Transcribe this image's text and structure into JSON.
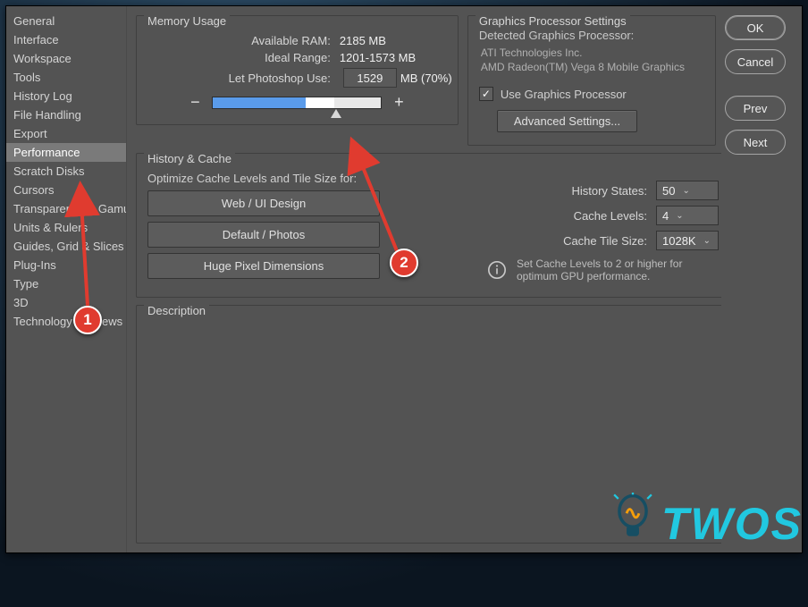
{
  "sidebar": {
    "items": [
      {
        "label": "General"
      },
      {
        "label": "Interface"
      },
      {
        "label": "Workspace"
      },
      {
        "label": "Tools"
      },
      {
        "label": "History Log"
      },
      {
        "label": "File Handling"
      },
      {
        "label": "Export"
      },
      {
        "label": "Performance",
        "selected": true
      },
      {
        "label": "Scratch Disks"
      },
      {
        "label": "Cursors"
      },
      {
        "label": "Transparency & Gamut"
      },
      {
        "label": "Units & Rulers"
      },
      {
        "label": "Guides, Grid & Slices"
      },
      {
        "label": "Plug-Ins"
      },
      {
        "label": "Type"
      },
      {
        "label": "3D"
      },
      {
        "label": "Technology Previews"
      }
    ]
  },
  "memory": {
    "title": "Memory Usage",
    "available_label": "Available RAM:",
    "available_value": "2185 MB",
    "ideal_label": "Ideal Range:",
    "ideal_value": "1201-1573 MB",
    "use_label": "Let Photoshop Use:",
    "use_value": "1529",
    "use_suffix": "MB (70%)",
    "minus": "−",
    "plus": "+"
  },
  "gpu": {
    "title": "Graphics Processor Settings",
    "detected_label": "Detected Graphics Processor:",
    "detected_line1": "ATI Technologies Inc.",
    "detected_line2": "AMD Radeon(TM) Vega 8 Mobile Graphics",
    "use_gpu_label": "Use Graphics Processor",
    "use_gpu_checked": true,
    "advanced_label": "Advanced Settings..."
  },
  "history_cache": {
    "title": "History & Cache",
    "optimize_label": "Optimize Cache Levels and Tile Size for:",
    "btn_web": "Web / UI Design",
    "btn_default": "Default / Photos",
    "btn_huge": "Huge Pixel Dimensions",
    "history_states_label": "History States:",
    "history_states_value": "50",
    "cache_levels_label": "Cache Levels:",
    "cache_levels_value": "4",
    "cache_tile_label": "Cache Tile Size:",
    "cache_tile_value": "1028K",
    "note": "Set Cache Levels to 2 or higher for optimum GPU performance."
  },
  "description": {
    "title": "Description"
  },
  "actions": {
    "ok": "OK",
    "cancel": "Cancel",
    "prev": "Prev",
    "next": "Next"
  },
  "annotations": {
    "one": "1",
    "two": "2"
  },
  "watermark": {
    "text": "TWOS"
  }
}
